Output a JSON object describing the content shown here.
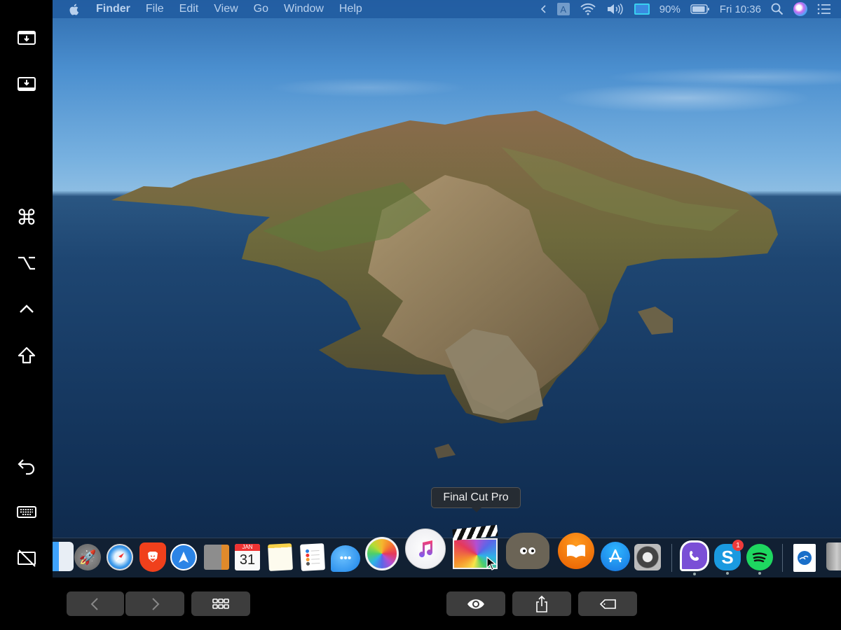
{
  "menubar": {
    "apple_icon": "apple-logo-icon",
    "app_name": "Finder",
    "menus": [
      "File",
      "Edit",
      "View",
      "Go",
      "Window",
      "Help"
    ],
    "status": {
      "collapse_icon": "chevron-left-icon",
      "input_source": "A",
      "wifi_icon": "wifi-icon",
      "volume_icon": "volume-icon",
      "sidecar_icon": "sidecar-display-icon",
      "battery_percent": "90%",
      "battery_level": 0.9,
      "battery_icon": "battery-icon",
      "clock": "Fri 10:36",
      "spotlight_icon": "search-icon",
      "siri_icon": "siri-icon",
      "notification_icon": "notification-center-icon"
    }
  },
  "sidebar": {
    "items": [
      {
        "name": "show-menubar-icon"
      },
      {
        "name": "show-dock-icon"
      },
      {
        "name": "command-key-icon",
        "glyph": "⌘"
      },
      {
        "name": "option-key-icon",
        "glyph": "⌥"
      },
      {
        "name": "control-key-icon",
        "glyph": "^"
      },
      {
        "name": "shift-key-icon",
        "glyph": "⇧"
      },
      {
        "name": "undo-icon"
      },
      {
        "name": "keyboard-icon"
      },
      {
        "name": "disconnect-display-icon"
      }
    ]
  },
  "dock": {
    "tooltip": "Final Cut Pro",
    "apps": [
      {
        "name": "Finder",
        "running": true
      },
      {
        "name": "Launchpad",
        "running": false
      },
      {
        "name": "Safari",
        "running": false
      },
      {
        "name": "Brave",
        "running": false
      },
      {
        "name": "Spark",
        "running": false
      },
      {
        "name": "Calculator",
        "running": false
      },
      {
        "name": "Calendar",
        "running": false,
        "month": "JAN",
        "day": "31"
      },
      {
        "name": "Notes",
        "running": false
      },
      {
        "name": "Reminders",
        "running": false
      },
      {
        "name": "Messages",
        "running": false
      },
      {
        "name": "Photos",
        "running": false
      },
      {
        "name": "Music",
        "running": false
      },
      {
        "name": "Final Cut Pro",
        "running": false
      },
      {
        "name": "GIMP",
        "running": false
      },
      {
        "name": "Books",
        "running": false
      },
      {
        "name": "App Store",
        "running": false
      },
      {
        "name": "System Preferences",
        "running": false
      },
      {
        "name": "Viber",
        "running": true
      },
      {
        "name": "Skype",
        "running": true,
        "badge": "1"
      },
      {
        "name": "Spotify",
        "running": true
      },
      {
        "name": "OpenOffice Document",
        "running": false
      },
      {
        "name": "Trash",
        "running": false
      }
    ]
  },
  "touchbar": {
    "buttons": [
      {
        "name": "back-button",
        "icon": "chevron-left-icon"
      },
      {
        "name": "forward-button",
        "icon": "chevron-right-icon"
      },
      {
        "name": "view-options-button",
        "icon": "grid-icon"
      },
      {
        "name": "quick-look-button",
        "icon": "eye-icon"
      },
      {
        "name": "share-button",
        "icon": "share-icon"
      },
      {
        "name": "tags-button",
        "icon": "tag-icon"
      }
    ]
  }
}
